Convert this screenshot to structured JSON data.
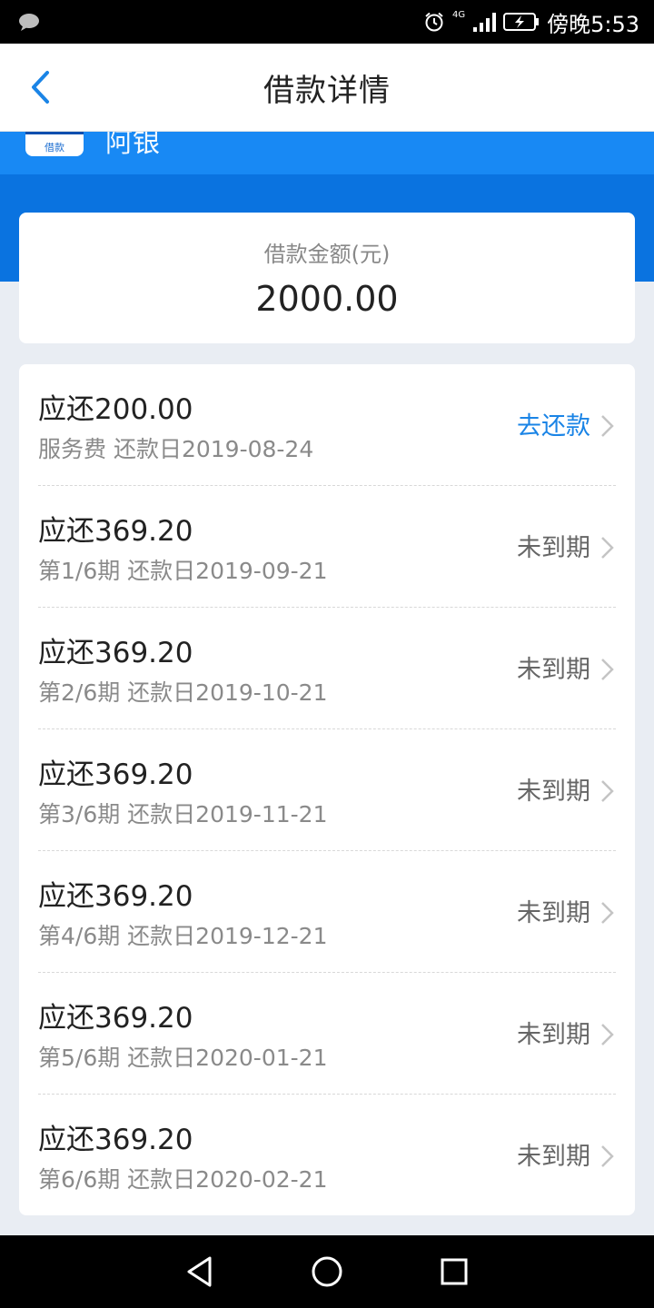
{
  "status_bar": {
    "time": "傍晚5:53",
    "network": "4G",
    "icons": [
      "chat-icon",
      "alarm-icon",
      "signal-icon",
      "battery-charging-icon"
    ]
  },
  "header": {
    "title": "借款详情",
    "back_icon": "chevron-left-icon"
  },
  "brand": {
    "logo_text": "借款",
    "name": "阿银"
  },
  "loan": {
    "label": "借款金额(元)",
    "amount": "2000.00"
  },
  "repayments": [
    {
      "title": "应还200.00",
      "subtitle": "服务费 还款日2019-08-24",
      "status": "去还款",
      "active": true
    },
    {
      "title": "应还369.20",
      "subtitle": "第1/6期 还款日2019-09-21",
      "status": "未到期",
      "active": false
    },
    {
      "title": "应还369.20",
      "subtitle": "第2/6期 还款日2019-10-21",
      "status": "未到期",
      "active": false
    },
    {
      "title": "应还369.20",
      "subtitle": "第3/6期 还款日2019-11-21",
      "status": "未到期",
      "active": false
    },
    {
      "title": "应还369.20",
      "subtitle": "第4/6期 还款日2019-12-21",
      "status": "未到期",
      "active": false
    },
    {
      "title": "应还369.20",
      "subtitle": "第5/6期 还款日2020-01-21",
      "status": "未到期",
      "active": false
    },
    {
      "title": "应还369.20",
      "subtitle": "第6/6期 还款日2020-02-21",
      "status": "未到期",
      "active": false
    }
  ],
  "colors": {
    "accent": "#1a84e6",
    "brand_blue": "#0a73e0",
    "page_bg": "#e9edf3"
  },
  "nav_bar": {
    "icons": [
      "back-triangle-icon",
      "home-circle-icon",
      "recents-square-icon"
    ]
  }
}
